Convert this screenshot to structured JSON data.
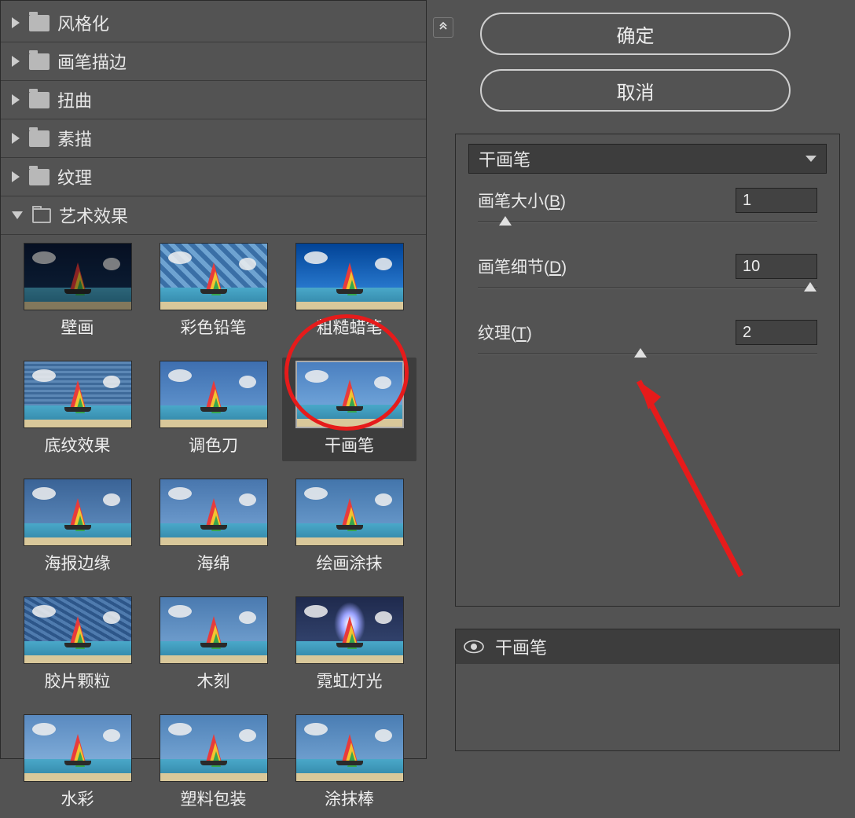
{
  "categories": [
    {
      "label": "风格化",
      "expanded": false
    },
    {
      "label": "画笔描边",
      "expanded": false
    },
    {
      "label": "扭曲",
      "expanded": false
    },
    {
      "label": "素描",
      "expanded": false
    },
    {
      "label": "纹理",
      "expanded": false
    },
    {
      "label": "艺术效果",
      "expanded": true
    }
  ],
  "filters": [
    {
      "label": "壁画"
    },
    {
      "label": "彩色铅笔"
    },
    {
      "label": "粗糙蜡笔"
    },
    {
      "label": "底纹效果"
    },
    {
      "label": "调色刀"
    },
    {
      "label": "干画笔",
      "selected": true
    },
    {
      "label": "海报边缘"
    },
    {
      "label": "海绵"
    },
    {
      "label": "绘画涂抹"
    },
    {
      "label": "胶片颗粒"
    },
    {
      "label": "木刻"
    },
    {
      "label": "霓虹灯光"
    },
    {
      "label": "水彩"
    },
    {
      "label": "塑料包装"
    },
    {
      "label": "涂抹棒"
    }
  ],
  "buttons": {
    "ok": "确定",
    "cancel": "取消"
  },
  "dropdown": {
    "selected": "干画笔"
  },
  "params": [
    {
      "label_text": "画笔大小",
      "label_key": "(",
      "label_u": "B",
      "label_close": ")",
      "value": "1",
      "pos": 8
    },
    {
      "label_text": "画笔细节",
      "label_key": "(",
      "label_u": "D",
      "label_close": ")",
      "value": "10",
      "pos": 98
    },
    {
      "label_text": "纹理",
      "label_key": "(",
      "label_u": "T",
      "label_close": ")",
      "value": "2",
      "pos": 48
    }
  ],
  "layer": {
    "name": "干画笔"
  },
  "thumb_styles": {
    "0": {
      "sky": "linear-gradient(#0a1a39,#15365e)",
      "extra": "dark"
    },
    "1": {
      "sky": "repeating-linear-gradient(45deg,#3a6fa6 0 6px,#6ea3d1 6px 12px)"
    },
    "2": {
      "sky": "linear-gradient(#2b4f7d,#5a8ab9)",
      "extra": "rough"
    },
    "3": {
      "sky": "repeating-linear-gradient(0deg,#3e6a9a 0 3px,#5c88b6 3px 6px)"
    },
    "4": {
      "sky": "linear-gradient(#3e6fb0,#6a9fd6)"
    },
    "5": {
      "sky": "linear-gradient(#4a7fc0,#7fb3e3)"
    },
    "6": {
      "sky": "linear-gradient(#3a6396,#6694c6)"
    },
    "7": {
      "sky": "linear-gradient(#4876ad,#7aa8d9)"
    },
    "8": {
      "sky": "linear-gradient(#4375ab,#74a4d4)"
    },
    "9": {
      "sky": "repeating-linear-gradient(30deg,#2d5689 0 4px,#4f7bae 4px 8px)"
    },
    "10": {
      "sky": "linear-gradient(#4a7ab0,#7dabd8)"
    },
    "11": {
      "sky": "linear-gradient(#1f2a4d,#3a4d7a)",
      "extra": "neon"
    },
    "12": {
      "sky": "linear-gradient(#5a8ac0,#8fbae2)"
    },
    "13": {
      "sky": "linear-gradient(#4f82b8,#83b1dd)"
    },
    "14": {
      "sky": "linear-gradient(#4a7db3,#7eadda)"
    }
  }
}
